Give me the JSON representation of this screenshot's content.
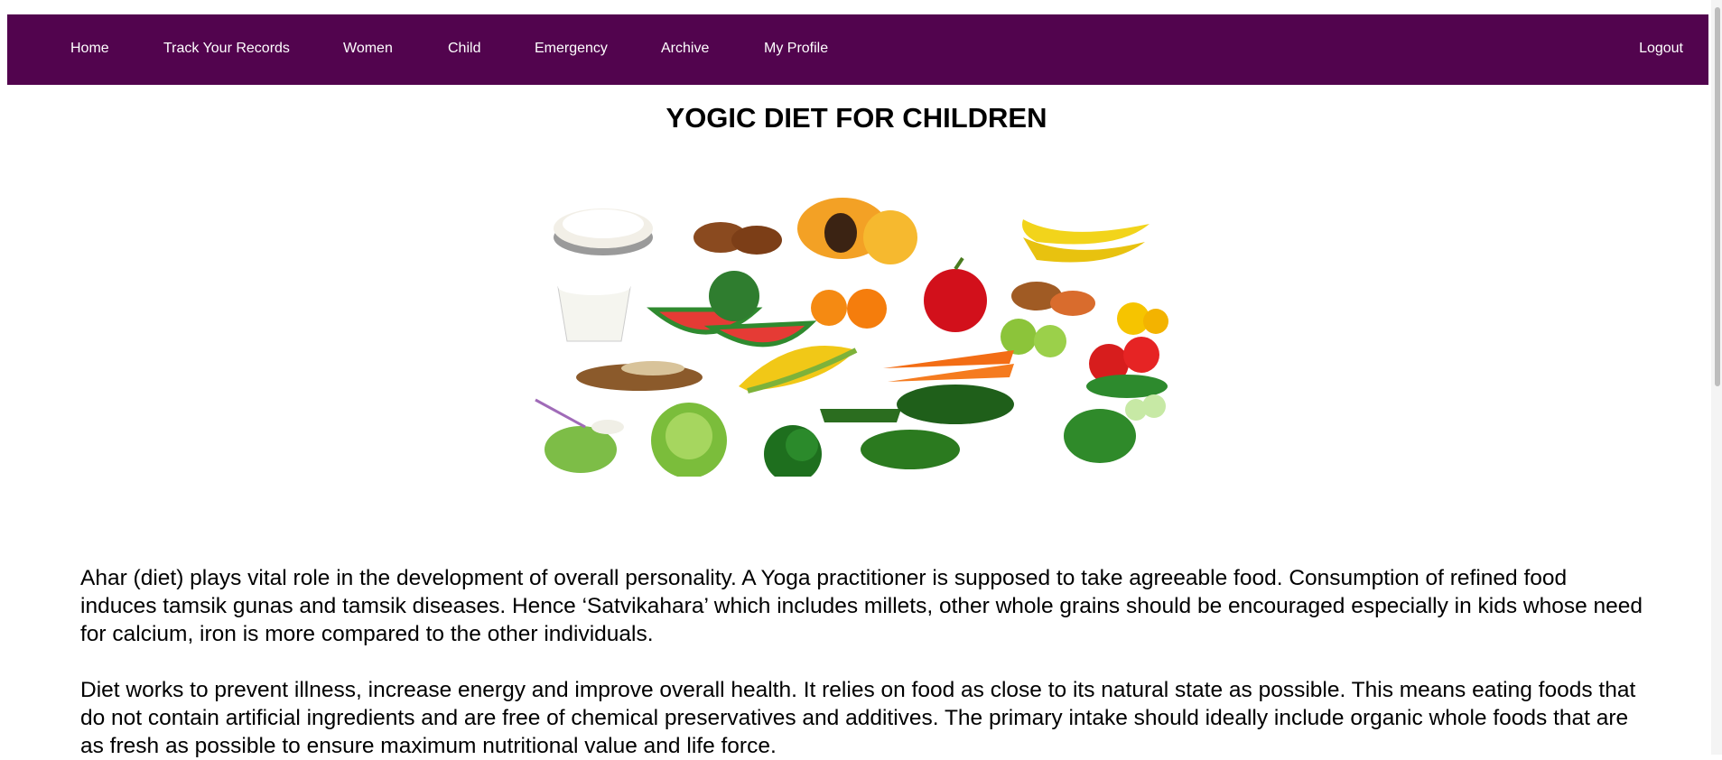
{
  "nav": {
    "items": [
      "Home",
      "Track Your Records",
      "Women",
      "Child",
      "Emergency",
      "Archive",
      "My Profile"
    ],
    "logout": "Logout"
  },
  "page": {
    "title": "YOGIC DIET FOR CHILDREN",
    "paragraphs": [
      "Ahar (diet) plays vital role in the development of overall personality. A Yoga practitioner is supposed to take agreeable food. Consumption of refined food induces tamsik gunas and tamsik diseases. Hence ‘Satvikahara’ which includes millets, other whole grains should be encouraged especially in kids whose need for calcium, iron is more compared to the other individuals.",
      "Diet works to prevent illness, increase energy and improve overall health. It relies on food as close to its natural state as possible. This means eating foods that do not contain artificial ingredients and are free of chemical preservatives and additives. The primary intake should ideally include organic whole foods that are as fresh as possible to ensure maximum nutritional value and life force."
    ]
  },
  "colors": {
    "nav_bg": "#52044e",
    "nav_text": "#ffffff"
  }
}
